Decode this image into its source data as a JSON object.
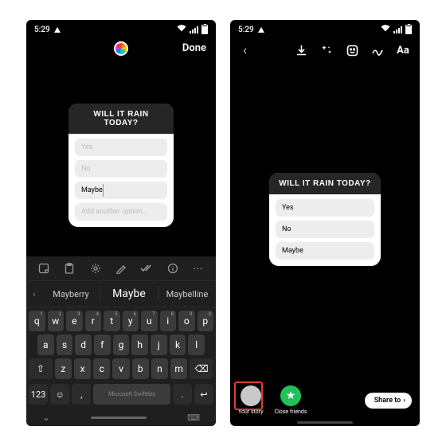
{
  "status": {
    "time": "5:29"
  },
  "left": {
    "done": "Done",
    "poll": {
      "title": "WILL IT RAIN TODAY?",
      "opt1": "Yes",
      "opt2": "No",
      "opt3": "Maybe",
      "add": "Add another option..."
    },
    "keyboard": {
      "suggestions": {
        "s1": "Mayberry",
        "s2": "Maybe",
        "s3": "Maybelline"
      },
      "row1": [
        "q",
        "w",
        "e",
        "r",
        "t",
        "y",
        "u",
        "i",
        "o",
        "p"
      ],
      "row1nums": [
        "1",
        "2",
        "3",
        "4",
        "5",
        "6",
        "7",
        "8",
        "9",
        "0"
      ],
      "row2": [
        "a",
        "s",
        "d",
        "f",
        "g",
        "h",
        "j",
        "k",
        "l"
      ],
      "row3": [
        "z",
        "x",
        "c",
        "v",
        "b",
        "n",
        "m"
      ],
      "shift": "⇧",
      "bksp": "⌫",
      "k123": "123",
      "emoji": "☺",
      "comma": ",",
      "space": "Microsoft SwiftKey",
      "period": ".",
      "enter": "↩"
    }
  },
  "right": {
    "poll": {
      "title": "WILL IT RAIN TODAY?",
      "opt1": "Yes",
      "opt2": "No",
      "opt3": "Maybe"
    },
    "share": {
      "your_story": "Your story",
      "close_friends": "Close friends",
      "share_to": "Share to",
      "cf_star": "★"
    },
    "tools": {
      "aa": "Aa"
    }
  }
}
